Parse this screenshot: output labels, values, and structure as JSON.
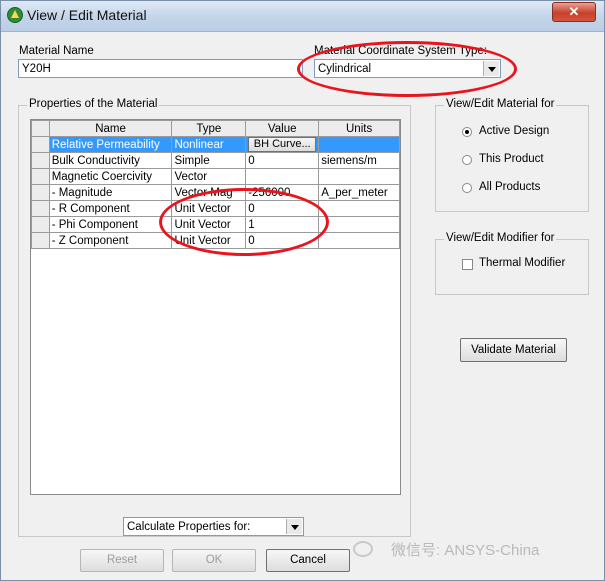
{
  "window": {
    "title": "View / Edit Material",
    "close_glyph": "✕"
  },
  "material_name": {
    "label": "Material Name",
    "value": "Y20H"
  },
  "coord_system": {
    "label": "Material Coordinate System Type:",
    "value": "Cylindrical"
  },
  "properties": {
    "group_title": "Properties of the Material",
    "columns": [
      "Name",
      "Type",
      "Value",
      "Units"
    ],
    "rows": [
      {
        "name": "Relative Permeability",
        "type": "Nonlinear",
        "value": "BH Curve...",
        "units": ""
      },
      {
        "name": "Bulk Conductivity",
        "type": "Simple",
        "value": "0",
        "units": "siemens/m"
      },
      {
        "name": "Magnetic Coercivity",
        "type": "Vector",
        "value": "",
        "units": ""
      },
      {
        "name": "- Magnitude",
        "type": "Vector Mag",
        "value": "-256000",
        "units": "A_per_meter"
      },
      {
        "name": "- R Component",
        "type": "Unit Vector",
        "value": "0",
        "units": ""
      },
      {
        "name": "- Phi Component",
        "type": "Unit Vector",
        "value": "1",
        "units": ""
      },
      {
        "name": "- Z Component",
        "type": "Unit Vector",
        "value": "0",
        "units": ""
      }
    ]
  },
  "view_edit_for": {
    "title": "View/Edit Material for",
    "options": [
      "Active Design",
      "This Product",
      "All Products"
    ],
    "selected": "Active Design"
  },
  "modifier": {
    "title": "View/Edit Modifier for",
    "thermal_label": "Thermal Modifier",
    "thermal_checked": false
  },
  "validate_label": "Validate Material",
  "calc_combo": {
    "value": "Calculate Properties for:"
  },
  "buttons": {
    "reset": "Reset",
    "ok": "OK",
    "cancel": "Cancel"
  },
  "watermark": "微信号: ANSYS-China",
  "colors": {
    "selection": "#3399ff",
    "annotation": "#e8141e"
  }
}
